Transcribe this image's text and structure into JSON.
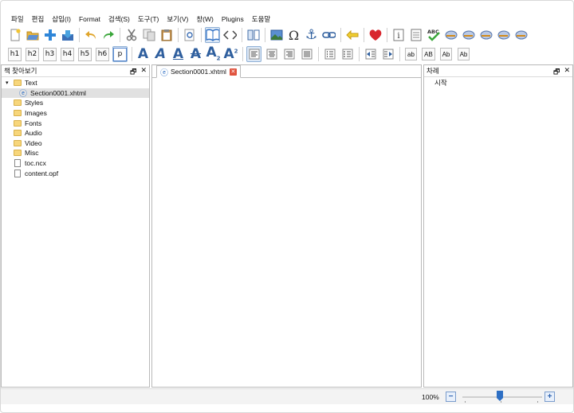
{
  "menu": [
    "파일",
    "편집",
    "삽입(I)",
    "Format",
    "검색(S)",
    "도구(T)",
    "보기(V)",
    "창(W)",
    "Plugins",
    "도움말"
  ],
  "headings": [
    "h1",
    "h2",
    "h3",
    "h4",
    "h5",
    "h6",
    "p"
  ],
  "case_buttons": [
    "ab",
    "AB",
    "Ab",
    "Ab"
  ],
  "book_browser": {
    "title": "책 찾아보기",
    "items": [
      {
        "label": "Text",
        "type": "folder",
        "level": 0
      },
      {
        "label": "Section0001.xhtml",
        "type": "xhtml",
        "level": 1
      },
      {
        "label": "Styles",
        "type": "folder",
        "level": 0
      },
      {
        "label": "Images",
        "type": "folder",
        "level": 0
      },
      {
        "label": "Fonts",
        "type": "folder",
        "level": 0
      },
      {
        "label": "Audio",
        "type": "folder",
        "level": 0
      },
      {
        "label": "Video",
        "type": "folder",
        "level": 0
      },
      {
        "label": "Misc",
        "type": "folder",
        "level": 0
      },
      {
        "label": "toc.ncx",
        "type": "file",
        "level": 0
      },
      {
        "label": "content.opf",
        "type": "file",
        "level": 0
      }
    ]
  },
  "editor": {
    "tab_label": "Section0001.xhtml"
  },
  "toc": {
    "title": "차례",
    "items": [
      "시작"
    ]
  },
  "status": {
    "zoom": "100%",
    "zoom_minus": "−",
    "zoom_plus": "+",
    "zoom_level": 0.5
  },
  "colors": {
    "accent": "#2f5f9e",
    "toolbar_blue": "#2e6fc4",
    "heart": "#d8262e",
    "folder": "#f7d67b",
    "tab_close": "#e0533e"
  }
}
